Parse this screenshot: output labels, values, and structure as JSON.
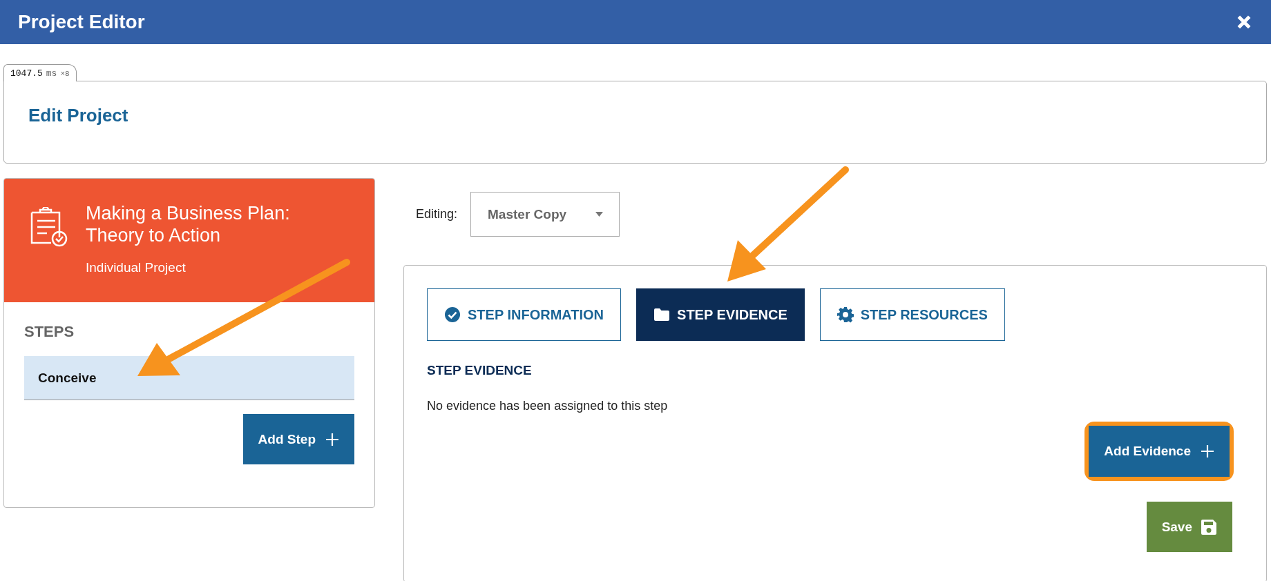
{
  "window": {
    "title": "Project Editor"
  },
  "timing_badge": {
    "value": "1047.5",
    "unit": "ms",
    "count": "×8"
  },
  "page": {
    "heading": "Edit Project"
  },
  "project": {
    "title": "Making a Business Plan: Theory to Action",
    "type": "Individual Project"
  },
  "steps": {
    "heading": "STEPS",
    "items": [
      {
        "label": "Conceive",
        "selected": true
      }
    ],
    "add_button": "Add Step"
  },
  "editing": {
    "label": "Editing:",
    "value": "Master Copy"
  },
  "tabs": [
    {
      "label": "STEP INFORMATION",
      "kind": "information",
      "selected": false
    },
    {
      "label": "STEP EVIDENCE",
      "kind": "evidence",
      "selected": true
    },
    {
      "label": "STEP RESOURCES",
      "kind": "resources",
      "selected": false
    }
  ],
  "evidence": {
    "heading": "STEP EVIDENCE",
    "empty_message": "No evidence has been assigned to this step",
    "add_button": "Add Evidence",
    "highlighted": true
  },
  "save_button": "Save"
}
